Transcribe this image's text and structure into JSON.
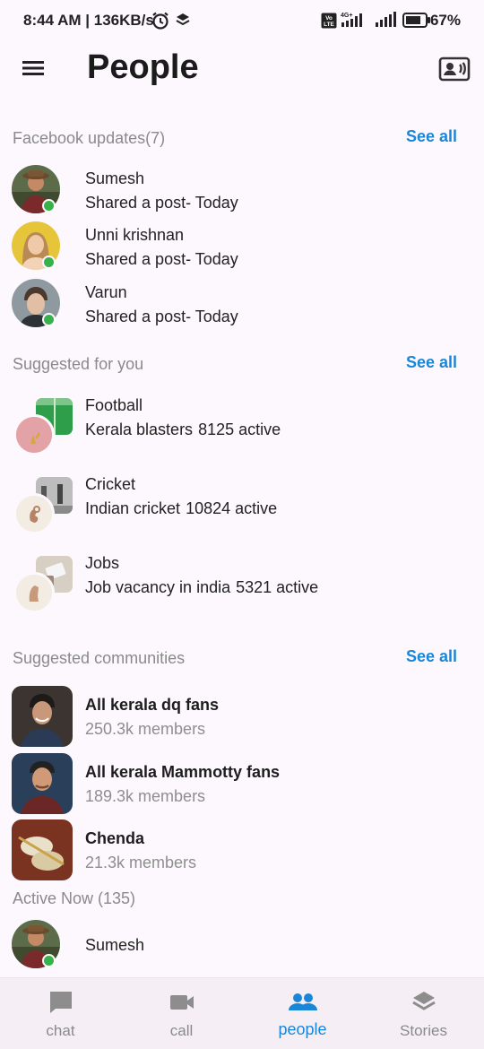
{
  "status_bar": {
    "time_speed": "8:44 AM | 136KB/s",
    "network_type": "4G+",
    "volte": "Vo LTE",
    "battery": "67%"
  },
  "app_bar": {
    "title": "People"
  },
  "facebook_updates": {
    "label": "Facebook updates(7)",
    "see_all": "See all",
    "items": [
      {
        "name": "Sumesh",
        "status": "Shared a post- Today"
      },
      {
        "name": "Unni krishnan",
        "status": "Shared a post- Today"
      },
      {
        "name": "Varun",
        "status": "Shared a post- Today"
      }
    ]
  },
  "suggested": {
    "label": "Suggested for you",
    "see_all": "See all",
    "items": [
      {
        "title": "Football",
        "subtitle": "Kerala blasters",
        "active": "8125 active"
      },
      {
        "title": "Cricket",
        "subtitle": "Indian cricket",
        "active": "10824 active"
      },
      {
        "title": "Jobs",
        "subtitle": "Job vacancy in india",
        "active": "5321 active"
      }
    ]
  },
  "communities": {
    "label": "Suggested communities",
    "see_all": "See all",
    "items": [
      {
        "name": "All kerala dq fans",
        "members": "250.3k members"
      },
      {
        "name": "All kerala Mammotty fans",
        "members": "189.3k members"
      },
      {
        "name": "Chenda",
        "members": "21.3k members"
      }
    ]
  },
  "active_now": {
    "label": "Active Now (135)",
    "items": [
      {
        "name": "Sumesh"
      }
    ]
  },
  "bottom_nav": {
    "items": [
      {
        "label": "chat",
        "icon": "chat-bubble-icon"
      },
      {
        "label": "call",
        "icon": "videocam-icon"
      },
      {
        "label": "people",
        "icon": "people-icon"
      },
      {
        "label": "Stories",
        "icon": "layers-icon"
      }
    ],
    "active": "people"
  },
  "colors": {
    "accent": "#1a86d8",
    "online": "#36b24a",
    "background": "#fcf8fd",
    "muted_text": "#8a8a8a"
  }
}
